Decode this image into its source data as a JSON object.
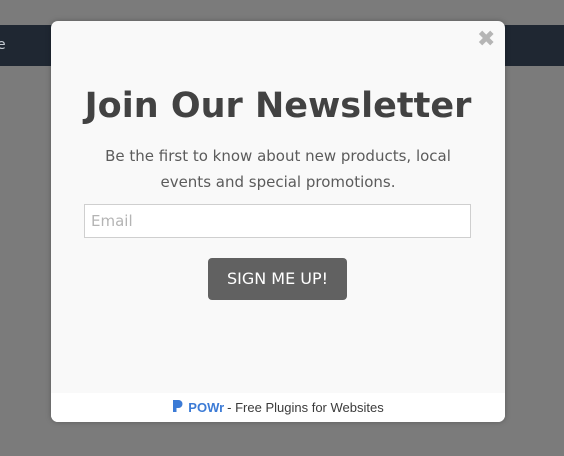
{
  "background_nav": {
    "fragment_text": "e"
  },
  "modal": {
    "close_glyph": "✖",
    "title": "Join Our Newsletter",
    "subtitle": "Be the first to know about new products, local events and special promotions.",
    "email_placeholder": "Email",
    "email_value": "",
    "submit_label": "SIGN ME UP!"
  },
  "footer": {
    "brand": "POWr",
    "tagline": "- Free Plugins for Websites",
    "logo_icon": "powr-logo-icon"
  },
  "colors": {
    "overlay": "#7b7b7b",
    "navbar": "#1f2732",
    "button": "#616161",
    "brand": "#3c7bd6"
  }
}
